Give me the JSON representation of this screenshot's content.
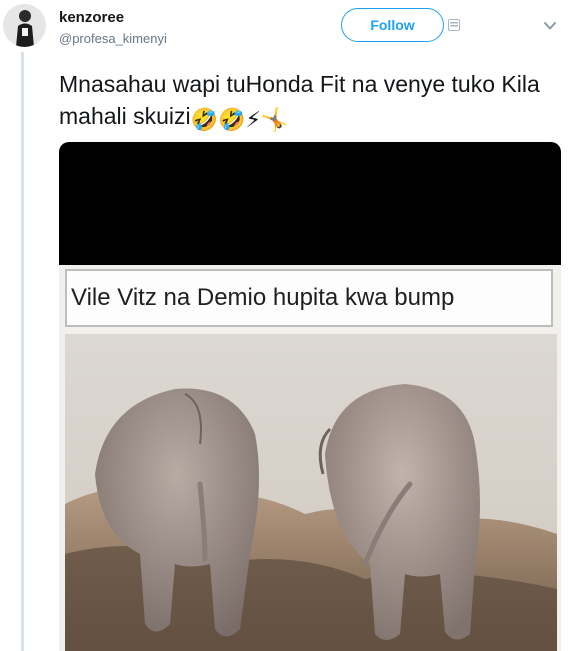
{
  "user": {
    "display_name": "kenzoree",
    "handle": "@profesa_kimenyi"
  },
  "actions": {
    "follow_label": "Follow"
  },
  "tweet": {
    "text": "Mnasahau wapi tuHonda Fit na venye tuko Kila mahali skuizi",
    "emojis": [
      "🤣",
      "🤣",
      "⚡",
      "🤸"
    ]
  },
  "media": {
    "caption": "Vile Vitz na Demio hupita kwa bump"
  },
  "colors": {
    "accent": "#1da1f2",
    "thread_line": "#d8e1e8",
    "handle_gray": "#657786"
  }
}
